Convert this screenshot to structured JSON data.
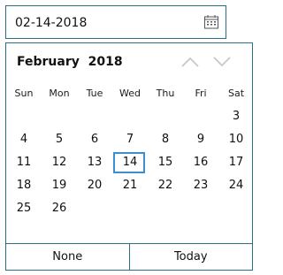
{
  "date_input": {
    "value": "02-14-2018",
    "icon": "calendar-icon"
  },
  "calendar": {
    "month": "February",
    "year": "2018",
    "nav": {
      "up_icon": "chevron-up-icon",
      "down_icon": "chevron-down-icon"
    },
    "weekdays": [
      "Sun",
      "Mon",
      "Tue",
      "Wed",
      "Thu",
      "Fri",
      "Sat"
    ],
    "weeks": [
      [
        "",
        "",
        "",
        "",
        "",
        "",
        "3"
      ],
      [
        "4",
        "5",
        "6",
        "7",
        "8",
        "9",
        "10"
      ],
      [
        "11",
        "12",
        "13",
        "14",
        "15",
        "16",
        "17"
      ],
      [
        "18",
        "19",
        "20",
        "21",
        "22",
        "23",
        "24"
      ],
      [
        "25",
        "26",
        "",
        "",
        "",
        "",
        ""
      ]
    ],
    "selected_day": "14",
    "footer": {
      "none_label": "None",
      "today_label": "Today"
    }
  },
  "colors": {
    "border": "#2a6f86",
    "selection": "#3c8fd3",
    "chevron": "#c8c8c8"
  }
}
